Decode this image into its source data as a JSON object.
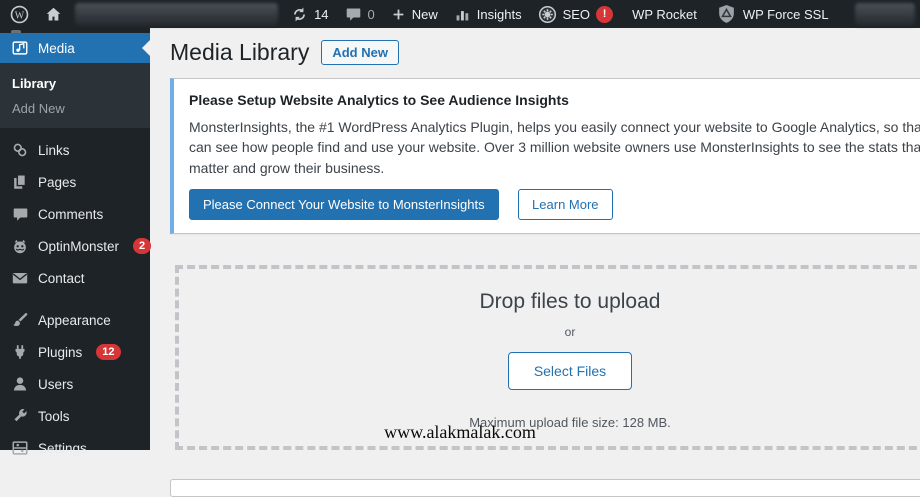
{
  "colors": {
    "accent_blue": "#2271b1",
    "admin_dark": "#1d2327",
    "badge_red": "#d63638",
    "notice_border_blue": "#72aee6",
    "content_bg": "#f0f0f1"
  },
  "admin_bar": {
    "wp_logo": "W",
    "updates_count": "14",
    "comments_count": "0",
    "new_label": "New",
    "insights_label": "Insights",
    "seo_label": "SEO",
    "seo_badge": "!",
    "wp_rocket_label": "WP Rocket",
    "wp_force_ssl_label": "WP Force SSL"
  },
  "sidebar": {
    "media_label": "Media",
    "submenu": {
      "library": "Library",
      "add_new": "Add New"
    },
    "items": [
      {
        "label": "Links"
      },
      {
        "label": "Pages"
      },
      {
        "label": "Comments"
      },
      {
        "label": "OptinMonster",
        "badge": "2"
      },
      {
        "label": "Contact"
      },
      {
        "label": "Appearance"
      },
      {
        "label": "Plugins",
        "badge": "12"
      },
      {
        "label": "Users"
      },
      {
        "label": "Tools"
      },
      {
        "label": "Settings"
      }
    ]
  },
  "page": {
    "title": "Media Library",
    "add_new_label": "Add New"
  },
  "notice": {
    "heading": "Please Setup Website Analytics to See Audience Insights",
    "body": "MonsterInsights, the #1 WordPress Analytics Plugin, helps you easily connect your website to Google Analytics, so that you can see how people find and use your website. Over 3 million website owners use MonsterInsights to see the stats that matter and grow their business.",
    "primary_button": "Please Connect Your Website to MonsterInsights",
    "secondary_button": "Learn More"
  },
  "uploader": {
    "heading": "Drop files to upload",
    "or_label": "or",
    "select_button": "Select Files",
    "max_size": "Maximum upload file size: 128 MB."
  },
  "watermark": "www.alakmalak.com"
}
